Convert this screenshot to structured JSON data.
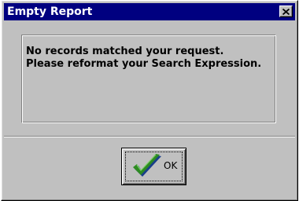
{
  "window": {
    "title": "Empty Report",
    "close_icon": "close-icon"
  },
  "message": {
    "line1": "No records matched your request.",
    "line2": "Please reformat your Search Expression."
  },
  "buttons": {
    "ok_label": "OK",
    "ok_icon": "checkmark-icon"
  },
  "colors": {
    "titlebar": "#000080",
    "dialog_face": "#c0c0c0",
    "check_green": "#2e8b22",
    "check_shadow": "#1a3f8a"
  }
}
